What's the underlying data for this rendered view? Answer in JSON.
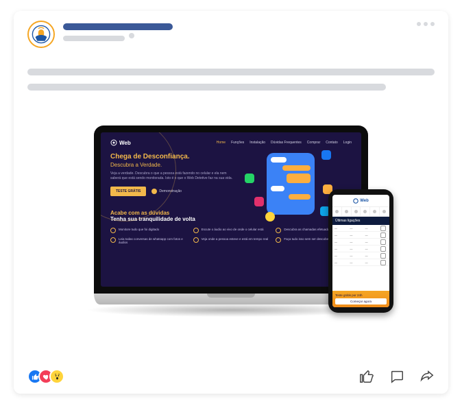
{
  "post": {
    "menu_icon": "more-horizontal"
  },
  "avatar": {
    "colors": {
      "outer": "#f5a623",
      "inner": "#1c56a5",
      "figure": "#f5a623"
    }
  },
  "laptop_page": {
    "logo": "Web",
    "nav": [
      "Home",
      "Funções",
      "Instalação",
      "Dúvidas Frequentes",
      "Comprar",
      "Contato",
      "Login"
    ],
    "hero": {
      "h1": "Chega de Desconfiança.",
      "h2": "Descubra a Verdade.",
      "p": "Veja a verdade. Descubra o que a pessoa está fazendo no celular e ela nem saberá que está sendo monitorada. Isto é o que o Web Detetive faz na sua vida.",
      "cta": "TESTE GRÁTIS",
      "demo": "Demonstração"
    },
    "sec2": {
      "a": "Acabe com as dúvidas",
      "b": "Tenha sua tranquilidade de volta",
      "features": [
        "Monitore tudo que foi digitado",
        "Escute o áudio ao vivo de onde o celular está",
        "Descubra as chamadas efetuadas e recebidas",
        "Leia todas conversas de whatsapp com fotos e áudios",
        "Veja onde a pessoa esteve e está em tempo real",
        "Faça tudo isso sem ser descoberto"
      ]
    }
  },
  "phone_page": {
    "logo": "Web",
    "section": "Últimas ligações",
    "rows": 6,
    "banner_line1": "Teste grátis por 24h",
    "banner_btn": "Começar agora"
  },
  "reactions": [
    "like",
    "love",
    "wow"
  ],
  "actions": [
    "like",
    "comment",
    "share"
  ]
}
